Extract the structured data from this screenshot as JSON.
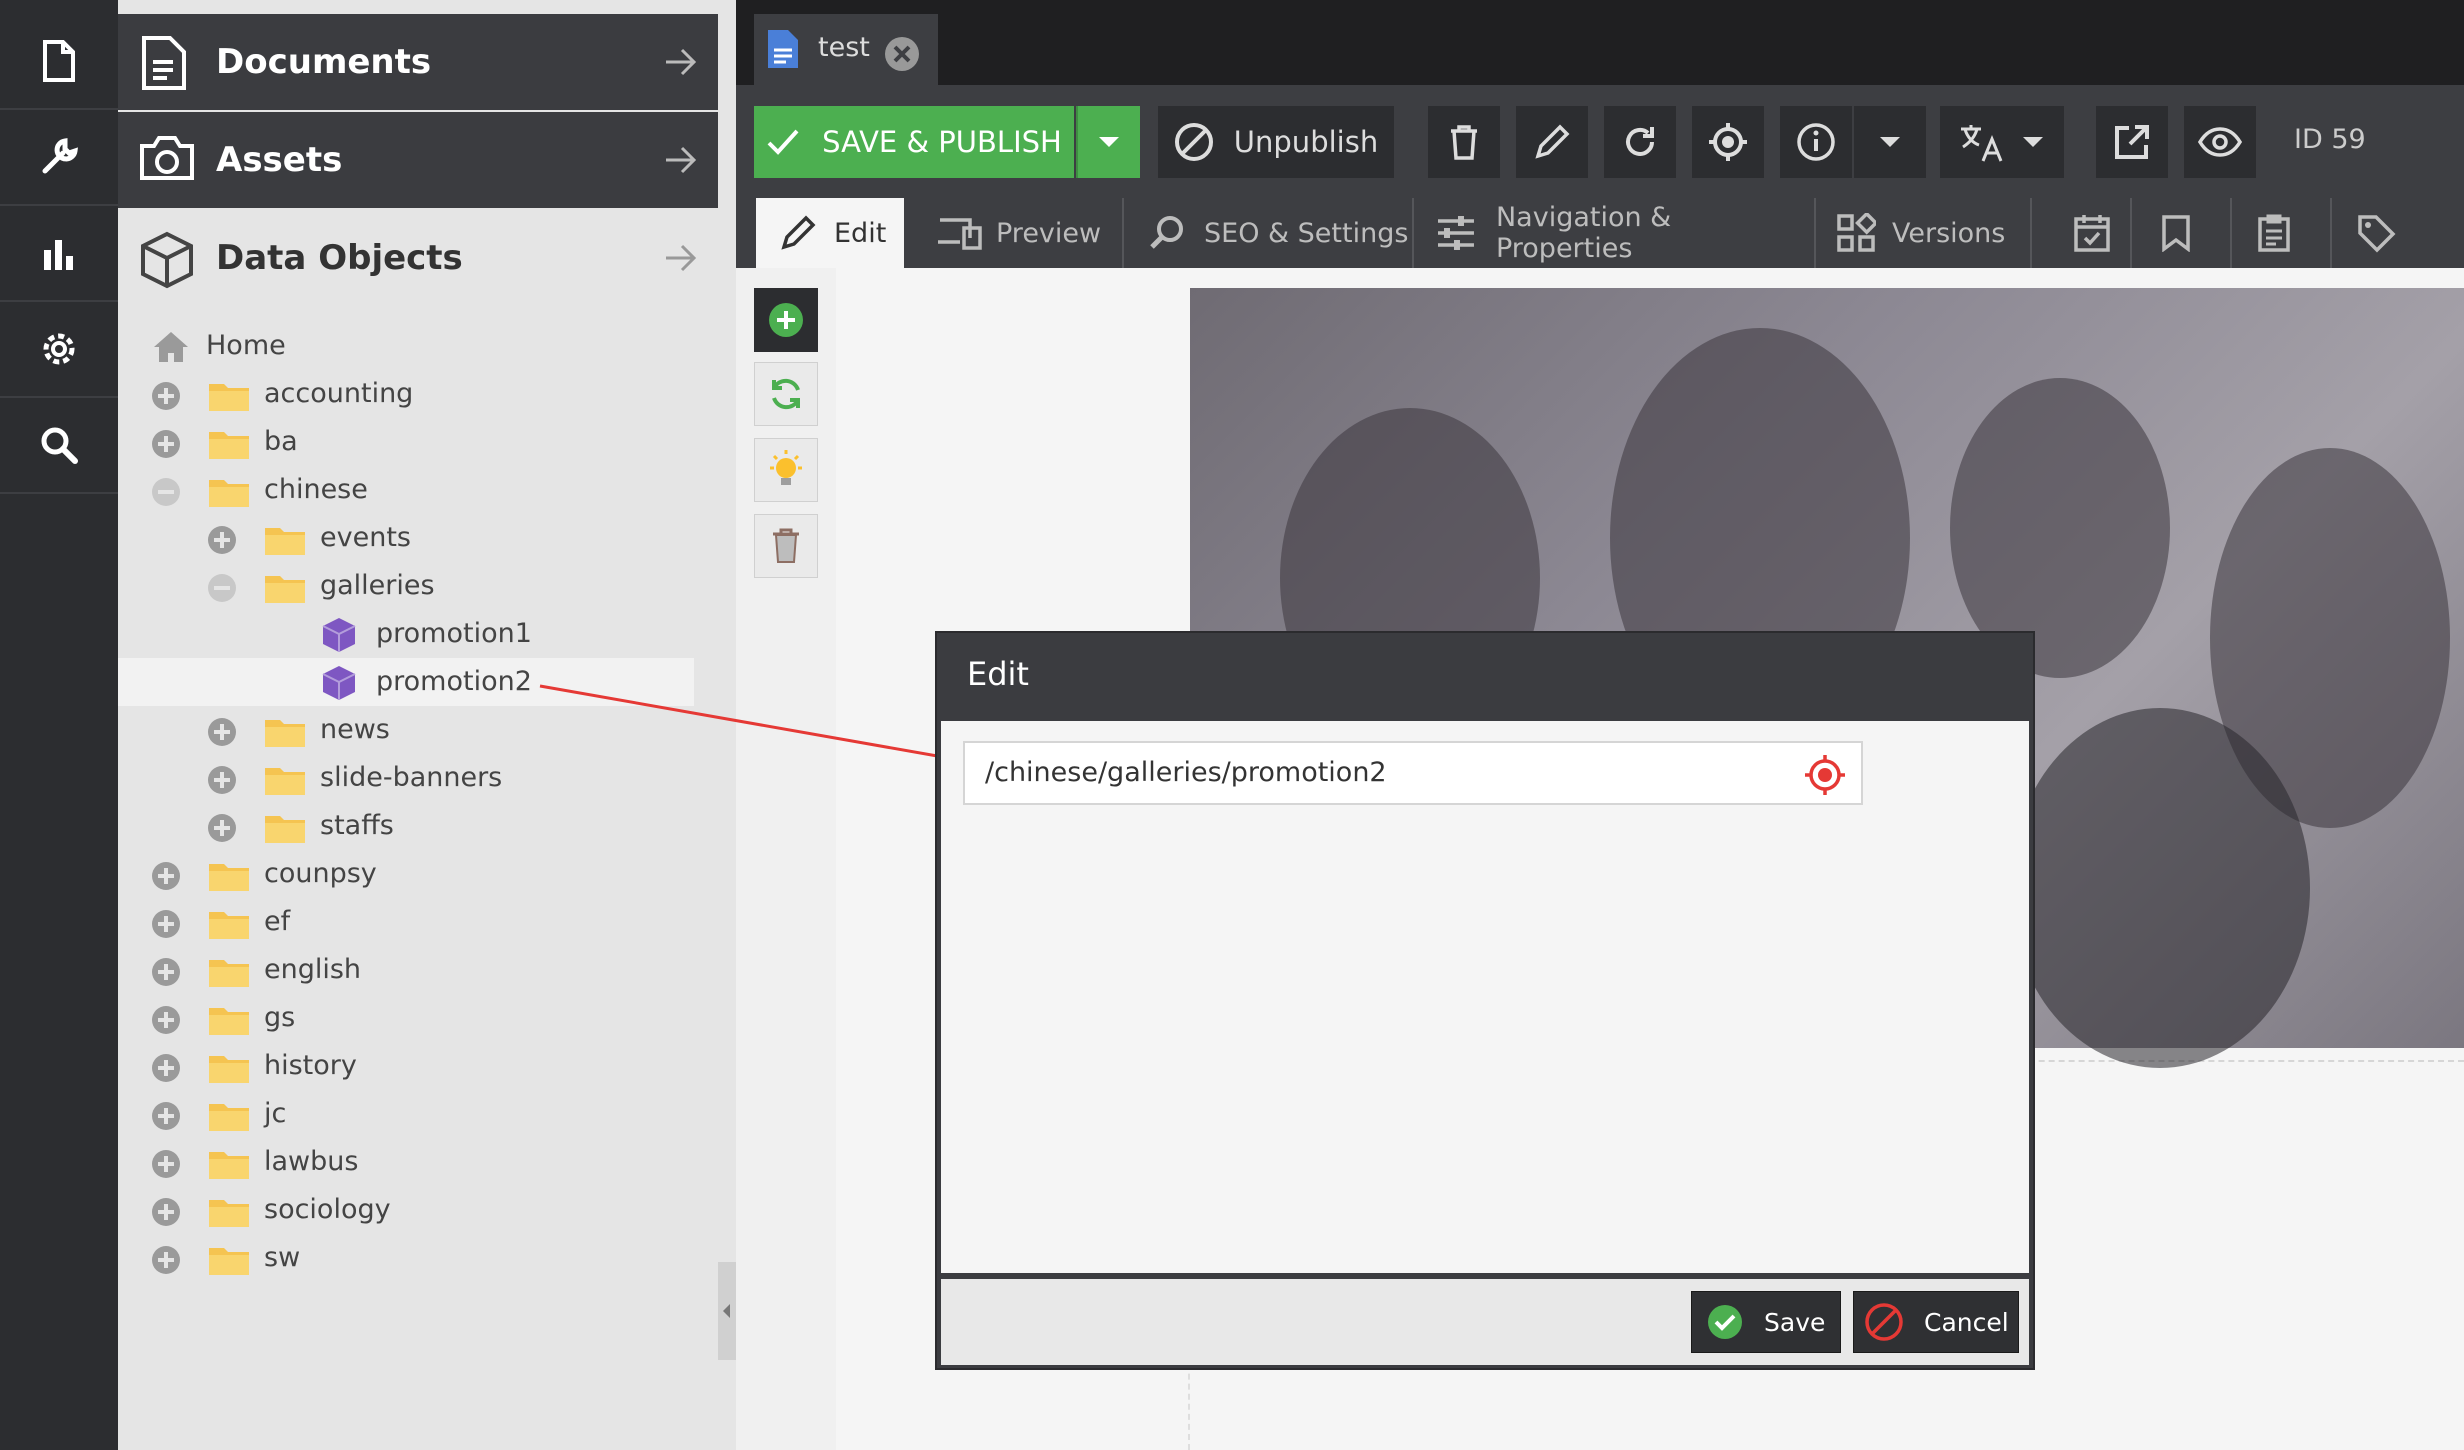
{
  "sidebar_icons": [
    "document-icon",
    "wrench-icon",
    "chart-icon",
    "gear-icon",
    "search-icon"
  ],
  "accordion": {
    "documents": "Documents",
    "assets": "Assets",
    "data_objects": "Data Objects"
  },
  "tree": {
    "home": "Home",
    "items": [
      {
        "label": "accounting",
        "level": 1,
        "state": "plus",
        "type": "folder"
      },
      {
        "label": "ba",
        "level": 1,
        "state": "plus",
        "type": "folder"
      },
      {
        "label": "chinese",
        "level": 1,
        "state": "minus",
        "type": "folder"
      },
      {
        "label": "events",
        "level": 2,
        "state": "plus",
        "type": "folder"
      },
      {
        "label": "galleries",
        "level": 2,
        "state": "minus",
        "type": "folder"
      },
      {
        "label": "promotion1",
        "level": 3,
        "state": "none",
        "type": "object"
      },
      {
        "label": "promotion2",
        "level": 3,
        "state": "none",
        "type": "object",
        "selected": true
      },
      {
        "label": "news",
        "level": 2,
        "state": "plus",
        "type": "folder"
      },
      {
        "label": "slide-banners",
        "level": 2,
        "state": "plus",
        "type": "folder"
      },
      {
        "label": "staffs",
        "level": 2,
        "state": "plus",
        "type": "folder"
      },
      {
        "label": "counpsy",
        "level": 1,
        "state": "plus",
        "type": "folder"
      },
      {
        "label": "ef",
        "level": 1,
        "state": "plus",
        "type": "folder"
      },
      {
        "label": "english",
        "level": 1,
        "state": "plus",
        "type": "folder"
      },
      {
        "label": "gs",
        "level": 1,
        "state": "plus",
        "type": "folder"
      },
      {
        "label": "history",
        "level": 1,
        "state": "plus",
        "type": "folder"
      },
      {
        "label": "jc",
        "level": 1,
        "state": "plus",
        "type": "folder"
      },
      {
        "label": "lawbus",
        "level": 1,
        "state": "plus",
        "type": "folder"
      },
      {
        "label": "sociology",
        "level": 1,
        "state": "plus",
        "type": "folder"
      },
      {
        "label": "sw",
        "level": 1,
        "state": "plus",
        "type": "folder"
      }
    ]
  },
  "tab": {
    "label": "test"
  },
  "toolbar": {
    "save_publish": "SAVE & PUBLISH",
    "unpublish": "Unpublish",
    "id_label": "ID 59"
  },
  "subtabs": {
    "edit": "Edit",
    "preview": "Preview",
    "seo": "SEO & Settings",
    "nav": "Navigation & Properties",
    "versions": "Versions"
  },
  "dialog": {
    "title": "Edit",
    "href_value": "/chinese/galleries/promotion2",
    "save": "Save",
    "cancel": "Cancel"
  },
  "colors": {
    "accent_green": "#4caf50",
    "dark_panel": "#3d3e42",
    "arrow_red": "#e53935",
    "folder": "#f5c451",
    "object_cube": "#7e57c2"
  }
}
